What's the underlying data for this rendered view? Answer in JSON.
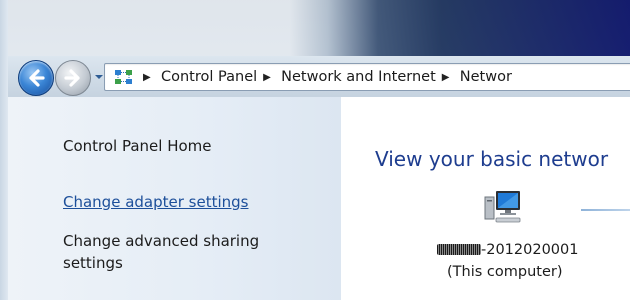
{
  "breadcrumb": {
    "items": [
      "Control Panel",
      "Network and Internet",
      "Networ"
    ]
  },
  "sidebar": {
    "home_label": "Control Panel Home",
    "change_adapter_label": "Change adapter settings",
    "advanced_sharing_label": "Change advanced sharing settings"
  },
  "main": {
    "title": "View your basic networ",
    "computer_name_suffix": "-2012020001",
    "computer_caption": "(This computer)"
  },
  "icons": {
    "back": "back-arrow-icon",
    "forward": "forward-arrow-icon",
    "history": "chevron-down-icon",
    "address": "network-control-panel-icon",
    "computer": "computer-icon"
  },
  "colors": {
    "link": "#1d4f9a",
    "title": "#1e3d8f",
    "left_pane": "#e5edf6"
  }
}
